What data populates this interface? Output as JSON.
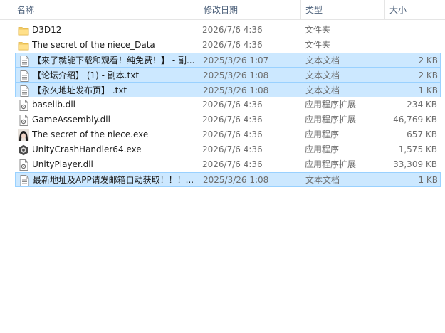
{
  "columns": {
    "name": "名称",
    "date": "修改日期",
    "type": "类型",
    "size": "大小"
  },
  "rows": [
    {
      "name": "D3D12",
      "date": "2026/7/6 4:36",
      "type": "文件夹",
      "size": "",
      "icon": "folder-icon",
      "selected": false
    },
    {
      "name": "The secret of the niece_Data",
      "date": "2026/7/6 4:36",
      "type": "文件夹",
      "size": "",
      "icon": "folder-icon",
      "selected": false
    },
    {
      "name": "【来了就能下载和观看！纯免费！】 - 副...",
      "date": "2025/3/26 1:07",
      "type": "文本文档",
      "size": "2 KB",
      "icon": "text-file-icon",
      "selected": true
    },
    {
      "name": "【论坛介绍】 (1) - 副本.txt",
      "date": "2025/3/26 1:08",
      "type": "文本文档",
      "size": "2 KB",
      "icon": "text-file-icon",
      "selected": true
    },
    {
      "name": "【永久地址发布页】 .txt",
      "date": "2025/3/26 1:08",
      "type": "文本文档",
      "size": "1 KB",
      "icon": "text-file-icon",
      "selected": true
    },
    {
      "name": "baselib.dll",
      "date": "2026/7/6 4:36",
      "type": "应用程序扩展",
      "size": "234 KB",
      "icon": "dll-file-icon",
      "selected": false
    },
    {
      "name": "GameAssembly.dll",
      "date": "2026/7/6 4:36",
      "type": "应用程序扩展",
      "size": "46,769 KB",
      "icon": "dll-file-icon",
      "selected": false
    },
    {
      "name": "The secret of the niece.exe",
      "date": "2026/7/6 4:36",
      "type": "应用程序",
      "size": "657 KB",
      "icon": "game-exe-icon",
      "selected": false
    },
    {
      "name": "UnityCrashHandler64.exe",
      "date": "2026/7/6 4:36",
      "type": "应用程序",
      "size": "1,575 KB",
      "icon": "unity-exe-icon",
      "selected": false
    },
    {
      "name": "UnityPlayer.dll",
      "date": "2026/7/6 4:36",
      "type": "应用程序扩展",
      "size": "33,309 KB",
      "icon": "dll-file-icon",
      "selected": false
    },
    {
      "name": "最新地址及APP请发邮箱自动获取！！！...",
      "date": "2025/3/26 1:08",
      "type": "文本文档",
      "size": "1 KB",
      "icon": "text-file-icon",
      "selected": true
    }
  ]
}
